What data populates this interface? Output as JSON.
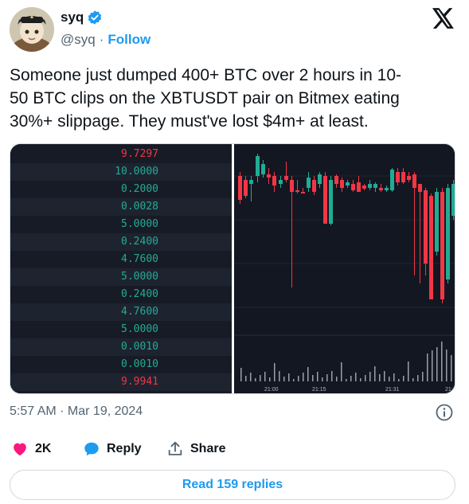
{
  "author": {
    "display_name": "syq",
    "handle": "@syq",
    "separator": "·",
    "follow_label": "Follow",
    "verified_color": "#1d9bf0"
  },
  "tweet": {
    "text": "Someone just dumped 400+ BTC over 2 hours in 10-\n50 BTC clips on the XBTUSDT pair on Bitmex eating\n30%+ slippage. They must've lost $4m+ at least.",
    "timestamp": "5:57 AM · Mar 19, 2024"
  },
  "orderbook": {
    "rows": [
      {
        "price": "9.7297",
        "color": "#f23645"
      },
      {
        "price": "10.0000",
        "color": "#22ab94"
      },
      {
        "price": "0.2000",
        "color": "#22ab94"
      },
      {
        "price": "0.0028",
        "color": "#22ab94"
      },
      {
        "price": "5.0000",
        "color": "#22ab94"
      },
      {
        "price": "0.2400",
        "color": "#22ab94"
      },
      {
        "price": "4.7600",
        "color": "#22ab94"
      },
      {
        "price": "5.0000",
        "color": "#22ab94"
      },
      {
        "price": "0.2400",
        "color": "#22ab94"
      },
      {
        "price": "4.7600",
        "color": "#22ab94"
      },
      {
        "price": "5.0000",
        "color": "#22ab94"
      },
      {
        "price": "0.0010",
        "color": "#22ab94"
      },
      {
        "price": "0.0010",
        "color": "#22ab94"
      },
      {
        "price": "9.9941",
        "color": "#f23645"
      }
    ]
  },
  "chart": {
    "time_labels": [
      "21:00",
      "21:15",
      "21:31",
      "21:4"
    ],
    "up_color": "#22ab94",
    "down_color": "#f23645"
  },
  "actions": {
    "like_count": "2K",
    "reply_label": "Reply",
    "share_label": "Share"
  },
  "read_replies_label": "Read 159 replies",
  "icons": {
    "logo": "x-logo-icon",
    "verified": "verified-badge-icon",
    "info": "info-icon",
    "like": "heart-icon",
    "reply": "reply-bubble-icon",
    "share": "share-icon"
  }
}
